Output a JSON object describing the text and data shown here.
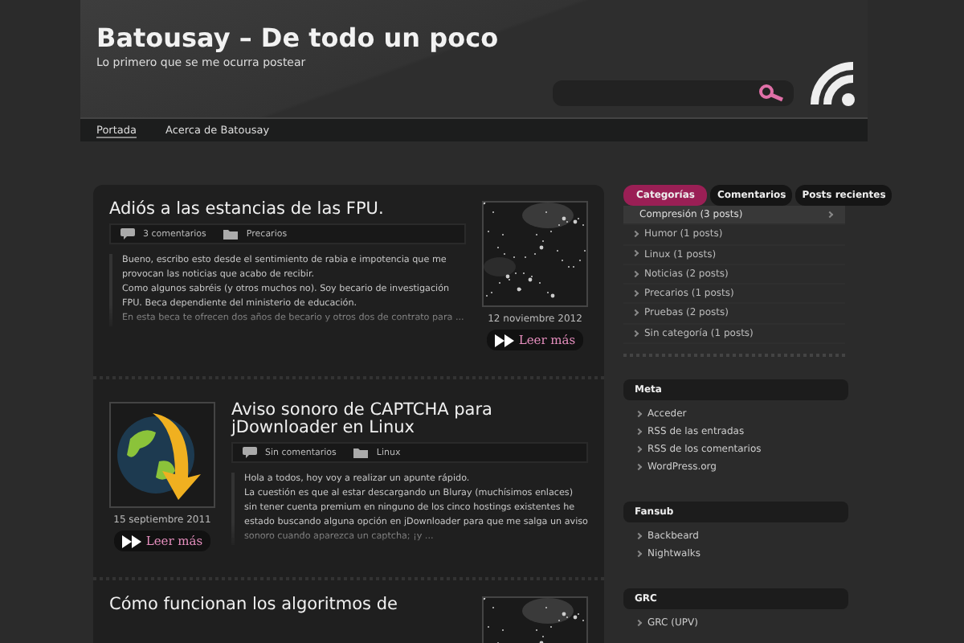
{
  "site": {
    "title": "Batousay – De todo un poco",
    "tagline": "Lo primero que se me ocurra postear"
  },
  "nav": [
    {
      "label": "Portada",
      "selected": true
    },
    {
      "label": "Acerca de Batousay",
      "selected": false
    }
  ],
  "posts": [
    {
      "title": "Adiós a las estancias de las FPU.",
      "comments": "3 comentarios",
      "category": "Precarios",
      "date": "12 noviembre 2012",
      "more": "Leer más",
      "paragraphs": [
        "Bueno, escribo esto desde el sentimiento de rabia e impotencia que me provocan las noticias que acabo de recibir.",
        "Como algunos sabréis (y otros muchos no). Soy becario de investigación FPU. Beca dependiente del ministerio de educación.",
        "En esta beca te ofrecen dos años de becario y otros dos de contrato para ..."
      ]
    },
    {
      "kind": "icon",
      "title": "Aviso sonoro de CAPTCHA para jDownloader en Linux",
      "comments": "Sin comentarios",
      "category": "Linux",
      "date": "15 septiembre 2011",
      "more": "Leer más",
      "paragraphs": [
        "Hola a todos, hoy voy a realizar un apunte rápido.",
        "La cuestión es que al estar descargando un Bluray (muchísimos enlaces) sin tener cuenta premium en ninguno de los cinco hostings existentes he estado buscando alguna opción en jDownloader para que me salga un aviso sonoro cuando aparezca un captcha; ¡y ..."
      ]
    },
    {
      "title": "Cómo funcionan los algoritmos de"
    }
  ],
  "sidebar": {
    "tabs": [
      {
        "label": "Categorías",
        "selected": true
      },
      {
        "label": "Comentarios",
        "selected": false
      },
      {
        "label": "Posts recientes",
        "selected": false
      }
    ],
    "categories": [
      {
        "label": "Compresión  (3 posts)",
        "selected": true
      },
      {
        "label": "Humor  (1 posts)",
        "selected": false
      },
      {
        "label": "Linux  (1 posts)",
        "selected": false
      },
      {
        "label": "Noticias  (2 posts)",
        "selected": false
      },
      {
        "label": "Precarios  (1 posts)",
        "selected": false
      },
      {
        "label": "Pruebas  (2 posts)",
        "selected": false
      },
      {
        "label": "Sin categoría  (1 posts)",
        "selected": false
      }
    ],
    "widgets": [
      {
        "title": "Meta",
        "links": [
          "Acceder",
          "RSS de las entradas",
          "RSS de los comentarios",
          "WordPress.org"
        ]
      },
      {
        "title": "Fansub",
        "links": [
          "Backbeard",
          "Nightwalks"
        ]
      },
      {
        "title": "GRC",
        "links": [
          "GRC (UPV)"
        ]
      }
    ]
  }
}
